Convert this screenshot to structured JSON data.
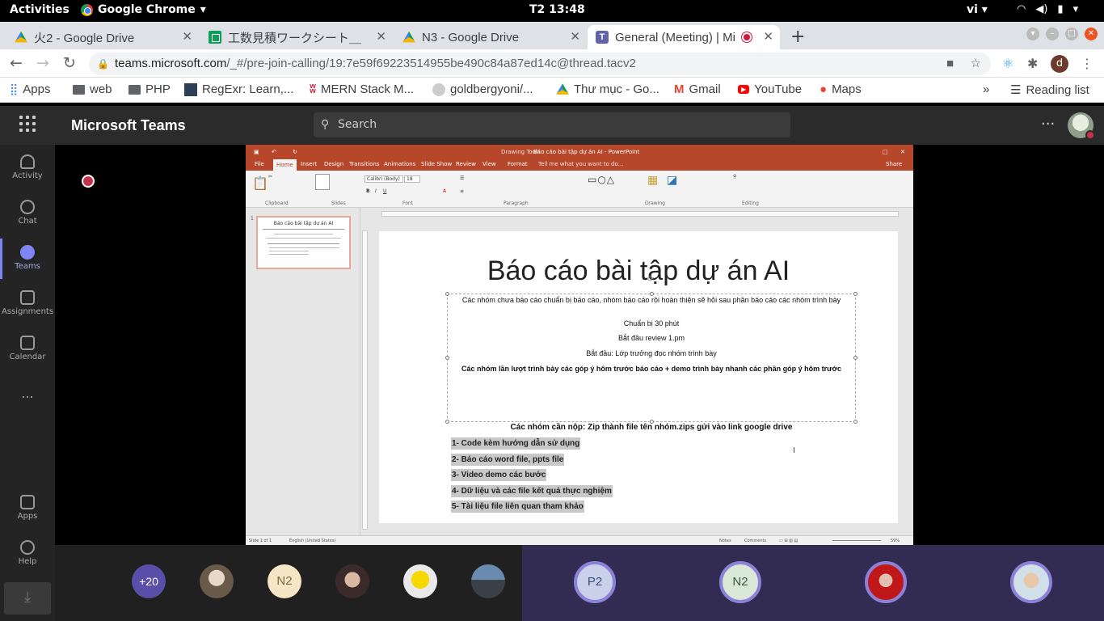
{
  "topbar": {
    "activities": "Activities",
    "app_name": "Google Chrome",
    "clock": "T2 13:48",
    "lang": "vi"
  },
  "tabs": [
    {
      "title": "火2 - Google Drive",
      "icon": "drive-icon"
    },
    {
      "title": "工数見積ワークシート＿",
      "icon": "sheets-icon"
    },
    {
      "title": "N3 - Google Drive",
      "icon": "drive-icon"
    },
    {
      "title": "General (Meeting) | Mi",
      "icon": "teams-icon",
      "active": true
    }
  ],
  "address": {
    "domain": "teams.microsoft.com",
    "path": "/_#/pre-join-calling/19:7e59f69223514955be490c84a87ed14c@thread.tacv2",
    "avatar_letter": "d"
  },
  "bookmarks": [
    {
      "label": "Apps",
      "icon": "apps-grid-icon"
    },
    {
      "label": "web",
      "icon": "folder-icon"
    },
    {
      "label": "PHP",
      "icon": "folder-icon"
    },
    {
      "label": "RegExr: Learn,...",
      "icon": "regexr-icon"
    },
    {
      "label": "MERN Stack M...",
      "icon": "mern-icon"
    },
    {
      "label": "goldbergyoni/...",
      "icon": "github-icon"
    },
    {
      "label": "Thư mục - Go...",
      "icon": "drive-icon"
    },
    {
      "label": "Gmail",
      "icon": "gmail-icon"
    },
    {
      "label": "YouTube",
      "icon": "youtube-icon"
    },
    {
      "label": "Maps",
      "icon": "maps-icon"
    }
  ],
  "reading_list": "Reading list",
  "teams": {
    "title": "Microsoft Teams",
    "search_placeholder": "Search",
    "rail": [
      {
        "label": "Activity",
        "icon": "bell-icon"
      },
      {
        "label": "Chat",
        "icon": "chat-icon"
      },
      {
        "label": "Teams",
        "icon": "teams-icon",
        "selected": true
      },
      {
        "label": "Assignments",
        "icon": "assignments-icon"
      },
      {
        "label": "Calendar",
        "icon": "calendar-icon"
      },
      {
        "label": "...",
        "icon": "more-icon"
      },
      {
        "label": "Apps",
        "icon": "apps-icon"
      },
      {
        "label": "Help",
        "icon": "help-icon"
      }
    ]
  },
  "ppt": {
    "window_title": "Báo cáo bài tập dự án AI - PowerPoint",
    "drawing_tools": "Drawing Tools",
    "tabs": [
      "File",
      "Home",
      "Insert",
      "Design",
      "Transitions",
      "Animations",
      "Slide Show",
      "Review",
      "View",
      "Format"
    ],
    "tell_me": "Tell me what you want to do...",
    "share": "Share",
    "ribbon_groups": [
      "Clipboard",
      "Slides",
      "Font",
      "Paragraph",
      "Drawing",
      "Editing"
    ],
    "font_name": "Calibri (Body)",
    "font_size": "18",
    "status_slide": "Slide 1 of 1",
    "status_lang": "English (United States)",
    "status_notes": "Notes",
    "status_comments": "Comments",
    "zoom": "59%",
    "thumb_number": "1"
  },
  "slide": {
    "title": "Báo cáo bài tập dự án AI",
    "line1": "Các nhóm chưa báo cáo chuẩn bị báo cáo, nhóm báo cáo rồi hoàn thiện sẽ hỏi sau phần báo cáo các nhóm trình bày",
    "line2": "Chuẩn bị  30 phút",
    "line3": "Bắt đầu review 1.pm",
    "line4": "Bắt đầu: Lớp trưởng đọc nhóm trình bày",
    "line5": "Các nhóm lần lượt trình bày các góp ý hôm trước  báo cáo + demo trình bày nhanh các phần góp ý hôm trước",
    "submit": "Các nhóm cần nộp:  Zip thành file tên nhóm.zips gửi vào link google drive",
    "items": [
      "1- Code kèm hướng dẫn sử dụng",
      "2- Báo cáo word file, ppts file",
      "3- Video demo các bước",
      "4- Dữ liệu và các file kết quả thực nghiệm",
      "5- Tài liệu file liên quan tham khảo"
    ]
  },
  "participants": {
    "overflow": "+20",
    "n2_label": "N2",
    "p2_label": "P2",
    "n2b_label": "N2"
  }
}
